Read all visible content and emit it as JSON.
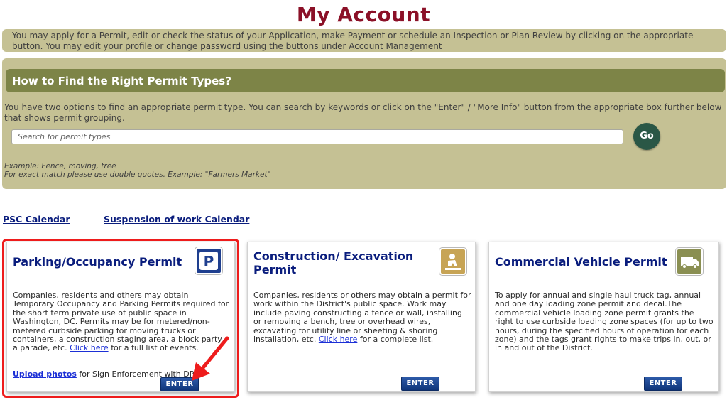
{
  "page": {
    "title": "My Account",
    "intro": "You may apply for a Permit, edit or check the status of your Application, make Payment or schedule an Inspection or Plan Review by clicking on the appropriate button. You may edit your profile or change password using the buttons under Account Management"
  },
  "find": {
    "title": "How to Find the Right Permit Types?",
    "description": "You have two options to find an appropriate permit type. You can search by keywords or click on the \"Enter\" / \"More Info\" button from the appropriate box further below that shows permit grouping.",
    "search_placeholder": "Search for permit types",
    "go_label": "Go",
    "example_line1": "Example: Fence, moving, tree",
    "example_line2": "For exact match please use double quotes. Example: \"Farmers Market\""
  },
  "links": {
    "psc_calendar": "PSC Calendar",
    "suspension_calendar": "Suspension of work Calendar"
  },
  "cards": {
    "parking": {
      "title": "Parking/Occupancy Permit",
      "desc": "Companies, residents and others may obtain Temporary Occupancy and Parking Permits required for the short term private use of public space in Washington, DC. Permits may be for metered/non-metered curbside parking for moving trucks or containers, a construction staging area, a block party, a parade, etc.",
      "link": "Click here",
      "desc_after": "for a full list of events.",
      "upload_link": "Upload photos",
      "upload_after": "for Sign Enforcement with DPW",
      "enter": "ENTER",
      "icon": "parking-icon"
    },
    "construction": {
      "title_line1": "Construction/ Excavation",
      "title_line2": "Permit",
      "desc": "Companies, residents or others may obtain a permit for work within the District's public space. Work may include paving constructing a fence or wall, installing or removing a bench, tree or overhead wires, excavating for utility line or sheeting & shoring installation, etc.",
      "link": "Click here",
      "desc_after": "for a complete list.",
      "enter": "ENTER",
      "icon": "construction-worker-icon"
    },
    "commercial": {
      "title": "Commercial Vehicle Permit",
      "desc": "To apply for annual and single haul truck tag, annual and one day loading zone permit and decal.The commercial vehicle loading zone permit grants the right to use curbside loading zone spaces (for up to two hours, during the specified hours of operation for each zone) and the tags grant rights to make trips in, out, or in and out of the District.",
      "enter": "ENTER",
      "icon": "truck-icon"
    }
  },
  "colors": {
    "title": "#8b1027",
    "panel": "#c5c194",
    "panel_header": "#7d8447",
    "link": "#0a1d7d",
    "highlight": "#ee1c1c"
  }
}
